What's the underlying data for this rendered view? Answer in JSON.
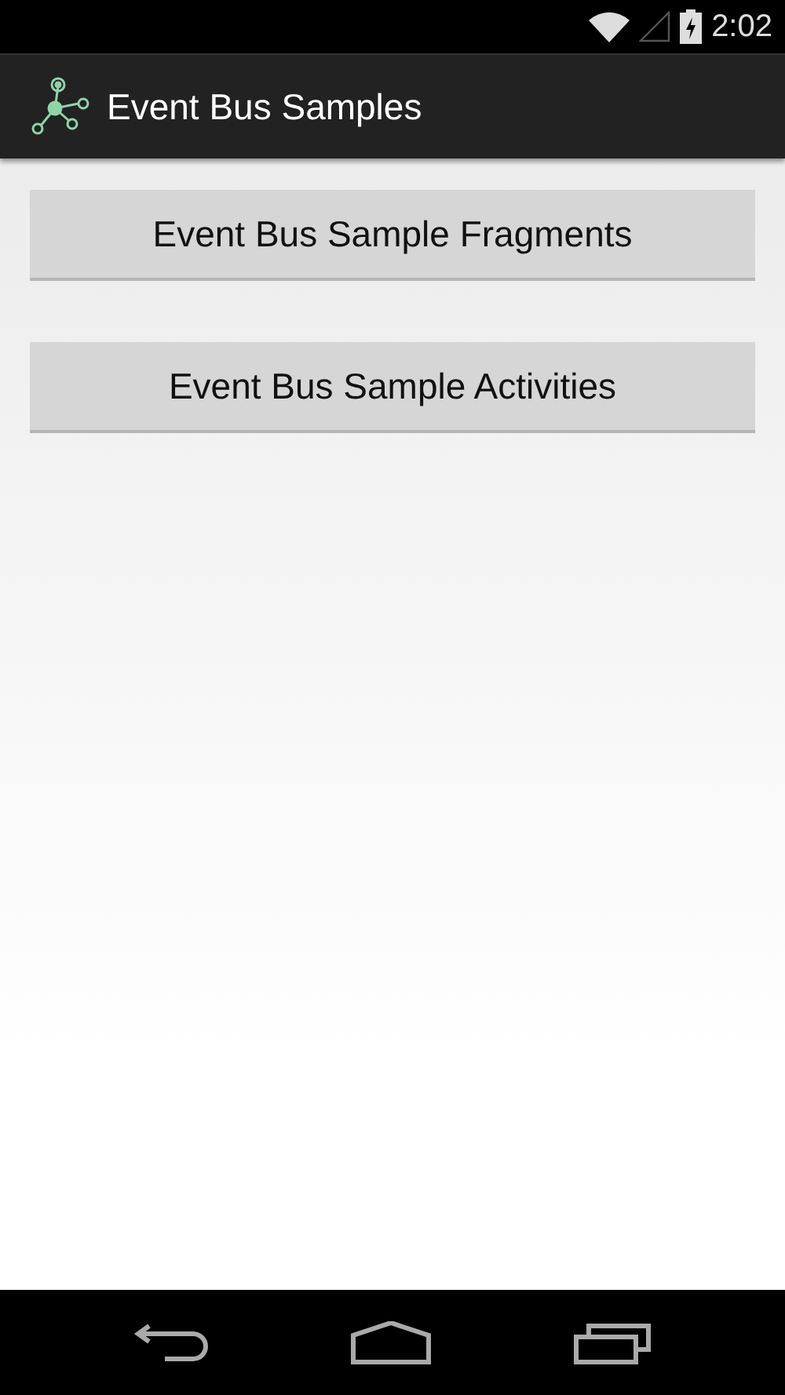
{
  "status_bar": {
    "time": "2:02"
  },
  "action_bar": {
    "title": "Event Bus Samples"
  },
  "buttons": [
    {
      "label": "Event Bus Sample Fragments"
    },
    {
      "label": "Event Bus Sample Activities"
    }
  ]
}
